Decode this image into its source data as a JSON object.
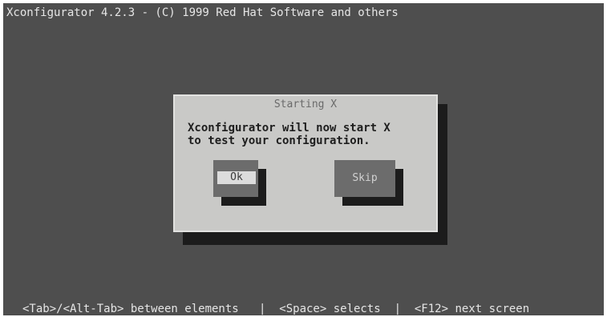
{
  "title_bar": {
    "text": "Xconfigurator 4.2.3 - (C) 1999 Red Hat Software and others"
  },
  "dialog": {
    "title": "Starting X",
    "message_lines": [
      "Xconfigurator will now start X",
      "to test your configuration."
    ],
    "buttons": {
      "ok_label": "Ok",
      "skip_label": "Skip"
    }
  },
  "help_line": {
    "text": "<Tab>/<Alt-Tab> between elements   |  <Space> selects  |  <F12> next screen"
  },
  "colors": {
    "screen_background": "#4e4e4e",
    "dialog_background": "#c9c9c7",
    "button_background": "#6c6c6c",
    "focused_label_background": "#dcdcdc",
    "shadow": "#1c1c1c"
  }
}
